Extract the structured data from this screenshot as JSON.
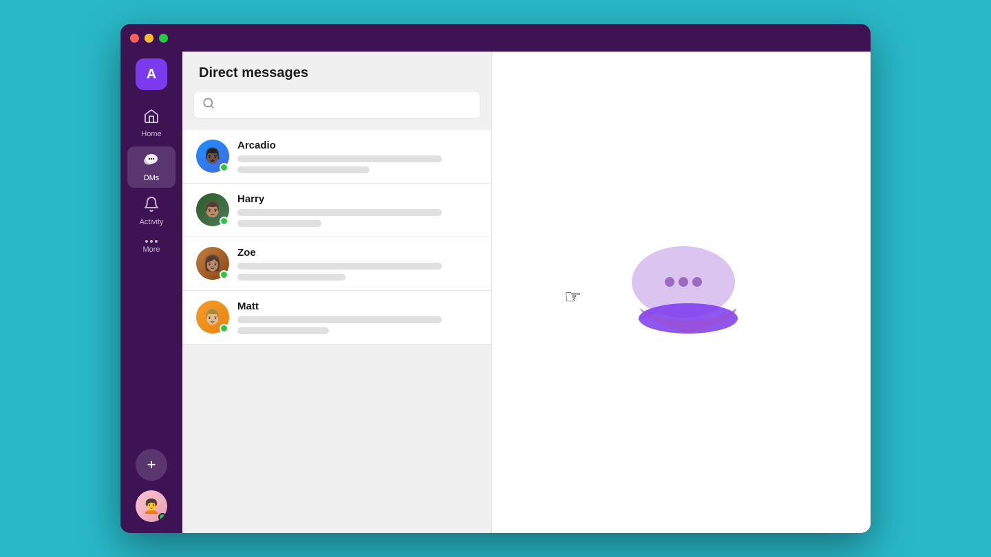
{
  "window": {
    "title": "Direct messages"
  },
  "sidebar": {
    "avatar_label": "A",
    "nav_items": [
      {
        "id": "home",
        "label": "Home",
        "icon": "🏠",
        "active": false
      },
      {
        "id": "dms",
        "label": "DMs",
        "icon": "👥",
        "active": true
      },
      {
        "id": "activity",
        "label": "Activity",
        "icon": "🔔",
        "active": false
      },
      {
        "id": "more",
        "label": "More",
        "icon": "...",
        "active": false
      }
    ]
  },
  "dm_panel": {
    "title": "Direct messages",
    "search_placeholder": "",
    "contacts": [
      {
        "id": "arcadio",
        "name": "Arcadio",
        "online": true
      },
      {
        "id": "harry",
        "name": "Harry",
        "online": true
      },
      {
        "id": "zoe",
        "name": "Zoe",
        "online": true
      },
      {
        "id": "matt",
        "name": "Matt",
        "online": true
      }
    ]
  },
  "icons": {
    "search": "⌕",
    "home": "⌂",
    "bell": "🔔",
    "dms": "💬",
    "add": "+",
    "close": "✕",
    "minimize": "−",
    "maximize": "□"
  }
}
